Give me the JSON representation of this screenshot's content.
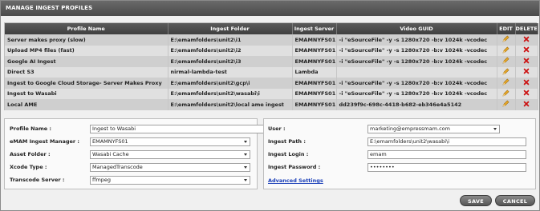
{
  "window": {
    "title": "MANAGE INGEST PROFILES"
  },
  "table": {
    "columns": [
      "Profile Name",
      "Ingest Folder",
      "Ingest Server",
      "Video GUID",
      "EDIT",
      "DELETE"
    ],
    "rows": [
      {
        "name": "Server makes proxy (slow)",
        "folder": "E:\\emamfolders\\unit2\\i1",
        "server": "EMAMNYFS01",
        "guid": "-i \"eSourceFile\" -y -s 1280x720 -b:v 1024k -vcodec"
      },
      {
        "name": "Upload MP4 files (fast)",
        "folder": "E:\\emamfolders\\unit2\\i2",
        "server": "EMAMNYFS01",
        "guid": "-i \"eSourceFile\" -y -s 1280x720 -b:v 1024k -vcodec"
      },
      {
        "name": "Google AI Ingest",
        "folder": "E:\\emamfolders\\unit2\\i3",
        "server": "EMAMNYFS01",
        "guid": "-i \"eSourceFile\" -y -s 1280x720 -b:v 1024k -vcodec"
      },
      {
        "name": "Direct S3",
        "folder": "nirmal-lambda-test",
        "server": "Lambda",
        "guid": ""
      },
      {
        "name": "Ingest to Google Cloud Storage- Server Makes Proxy",
        "folder": "E:\\emamfolders\\unit2\\gcp\\i",
        "server": "EMAMNYFS01",
        "guid": "-i \"eSourceFile\" -y -s 1280x720 -b:v 1024k -vcodec"
      },
      {
        "name": "Ingest to Wasabi",
        "folder": "E:\\emamfolders\\unit2\\wasabi\\i",
        "server": "EMAMNYFS01",
        "guid": "-i \"eSourceFile\" -y -s 1280x720 -b:v 1024k -vcodec"
      },
      {
        "name": "Local AME",
        "folder": "E:\\emamfolders\\unit2\\local ame ingest",
        "server": "EMAMNYFS01",
        "guid": "dd239f9c-698c-4418-b682-eb346e4a5142"
      }
    ]
  },
  "form": {
    "profile_name": {
      "label": "Profile Name :",
      "value": "Ingest to Wasabi"
    },
    "ingest_manager": {
      "label": "eMAM Ingest Manager :",
      "value": "EMAMNYFS01"
    },
    "asset_folder": {
      "label": "Asset Folder :",
      "value": "Wasabi Cache"
    },
    "xcode_type": {
      "label": "Xcode Type :",
      "value": "ManagedTranscode"
    },
    "transcode_server": {
      "label": "Transcode Server :",
      "value": "ffmpeg"
    },
    "user": {
      "label": "User :",
      "value": "marketing@empressmam.com"
    },
    "ingest_path": {
      "label": "Ingest Path :",
      "value": "E:\\emamfolders\\unit2\\wasabi\\i"
    },
    "ingest_login": {
      "label": "Ingest Login :",
      "value": "emam"
    },
    "ingest_password": {
      "label": "Ingest Password :",
      "value": "••••••••"
    },
    "advanced_settings": "Advanced Settings"
  },
  "buttons": {
    "save": "SAVE",
    "cancel": "CANCEL"
  },
  "colors": {
    "edit_icon": "#e0a030",
    "delete_icon": "#cc1111",
    "link": "#1a3fb8"
  }
}
